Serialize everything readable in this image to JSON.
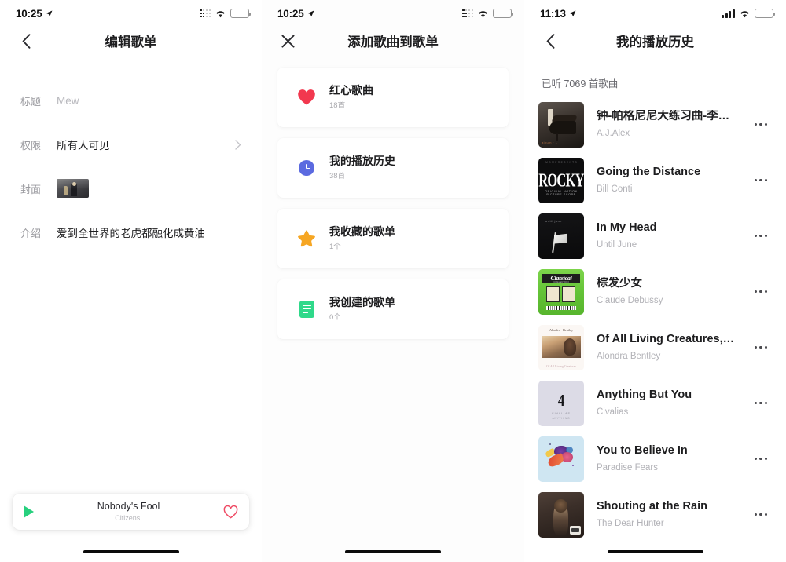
{
  "panel1": {
    "status": {
      "time": "10:25",
      "signal_icon": "signal-dots-icon",
      "wifi_icon": "wifi-icon",
      "battery_icon": "battery-icon",
      "location_icon": "location-arrow-icon"
    },
    "nav": {
      "back_icon": "chevron-left-icon",
      "title": "编辑歌单"
    },
    "form": [
      {
        "label": "标题",
        "value": "Mew",
        "is_placeholder": true,
        "name": "title"
      },
      {
        "label": "权限",
        "value": "所有人可见",
        "is_placeholder": false,
        "name": "permission",
        "chevron": "chevron-right-icon"
      },
      {
        "label": "封面",
        "value": "",
        "is_placeholder": false,
        "name": "cover"
      },
      {
        "label": "介绍",
        "value": "爱到全世界的老虎都融化成黄油",
        "is_placeholder": false,
        "name": "intro"
      }
    ],
    "player": {
      "play_icon": "play-icon",
      "title": "Nobody's Fool",
      "artist": "Citizens!",
      "like_icon": "heart-outline-icon",
      "like_color": "#ef4a64",
      "play_color": "#27d07e"
    }
  },
  "panel2": {
    "status": {
      "time": "10:25",
      "signal_icon": "signal-dots-icon",
      "wifi_icon": "wifi-icon",
      "battery_icon": "battery-icon",
      "location_icon": "location-arrow-icon"
    },
    "nav": {
      "close_icon": "close-x-icon",
      "title": "添加歌曲到歌单"
    },
    "cards": [
      {
        "icon": "heart-filled-icon",
        "color": "#f2384f",
        "title": "红心歌曲",
        "subtitle": "18首"
      },
      {
        "icon": "clock-icon",
        "color": "#5b6ae0",
        "title": "我的播放历史",
        "subtitle": "38首"
      },
      {
        "icon": "star-icon",
        "color": "#f6a623",
        "title": "我收藏的歌单",
        "subtitle": "1个"
      },
      {
        "icon": "playlist-icon",
        "color": "#2fd98a",
        "title": "我创建的歌单",
        "subtitle": "0个"
      }
    ]
  },
  "panel3": {
    "status": {
      "time": "11:13",
      "signal_icon": "signal-bars-icon",
      "wifi_icon": "wifi-icon",
      "battery_icon": "battery-icon",
      "location_icon": "location-arrow-icon"
    },
    "nav": {
      "back_icon": "chevron-left-icon",
      "title": "我的播放历史"
    },
    "count_text": "已听 7069 首歌曲",
    "songs": [
      {
        "title": "钟-帕格尼尼大练习曲-李…",
        "artist": "A.J.Alex",
        "art": "piano",
        "more_icon": "more-dots-icon"
      },
      {
        "title": "Going the Distance",
        "artist": "Bill Conti",
        "art": "rocky",
        "more_icon": "more-dots-icon"
      },
      {
        "title": "In My Head",
        "artist": "Until June",
        "art": "head",
        "more_icon": "more-dots-icon"
      },
      {
        "title": "棕发少女",
        "artist": "Claude Debussy",
        "art": "classical",
        "more_icon": "more-dots-icon"
      },
      {
        "title": "Of All Living Creatures,…",
        "artist": "Alondra Bentley",
        "art": "creatures",
        "more_icon": "more-dots-icon"
      },
      {
        "title": "Anything But You",
        "artist": "Civalias",
        "art": "anything",
        "more_icon": "more-dots-icon"
      },
      {
        "title": "You to Believe In",
        "artist": "Paradise Fears",
        "art": "believe",
        "more_icon": "more-dots-icon"
      },
      {
        "title": "Shouting at the Rain",
        "artist": "The Dear Hunter",
        "art": "rain",
        "more_icon": "more-dots-icon"
      }
    ]
  },
  "art_labels": {
    "rocky_word": "ROCKY",
    "rocky_top": "M G M  P R E S E N T S",
    "rocky_sub": "ORIGINAL MOTION PICTURE SCORE",
    "head_tt": "until june",
    "classical_word": "Classical",
    "classical_sub": "COLLECTION",
    "creatures_hd": "Alondra · Bentley",
    "creatures_hd_sub": "OF ALL LIVING CREATURES",
    "creatures_ft": "Of All Living Creatures",
    "anything_num": "4",
    "anything_l1": "CIVALIAS",
    "anything_l2": "ANYTHING"
  }
}
